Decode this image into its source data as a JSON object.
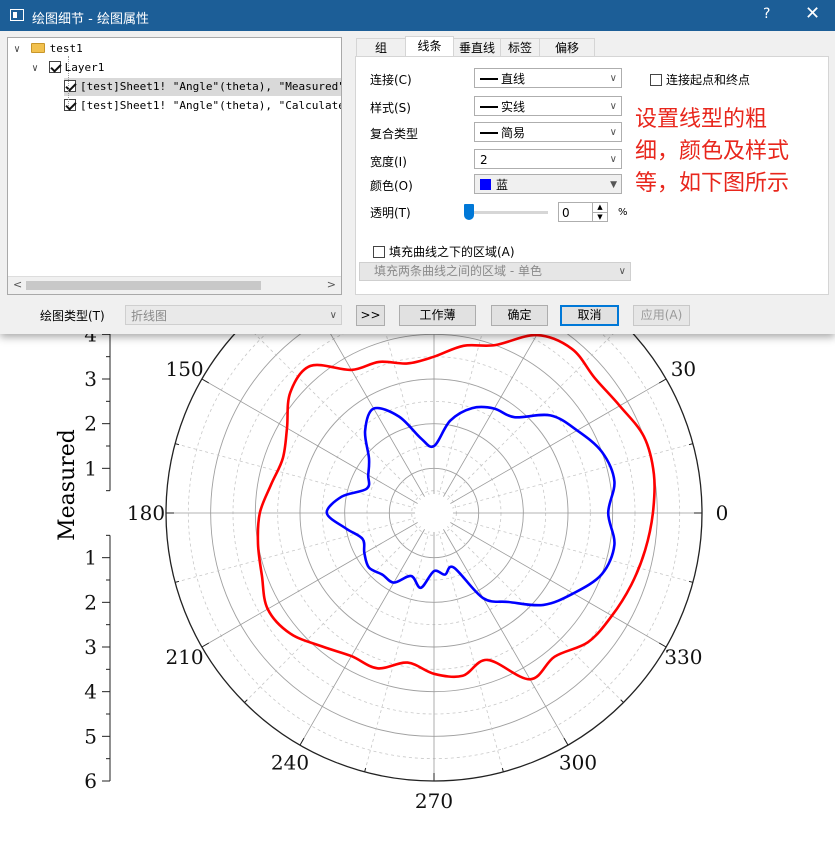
{
  "window": {
    "title": "绘图细节 - 绘图属性",
    "help": "?",
    "close": "✕"
  },
  "tree": {
    "root": "test1",
    "layer": "Layer1",
    "plots": [
      "[test]Sheet1! \"Angle\"(theta), \"Measured\"",
      "[test]Sheet1! \"Angle\"(theta), \"Calculated\""
    ]
  },
  "tabs": [
    "组",
    "线条",
    "垂直线",
    "标签",
    "偏移"
  ],
  "active_tab": "线条",
  "line_settings": {
    "connect_label": "连接(C)",
    "connect_value": "直线",
    "endpoints_label": "连接起点和终点",
    "style_label": "样式(S)",
    "style_value": "实线",
    "composite_label": "复合类型",
    "composite_value": "简易",
    "width_label": "宽度(I)",
    "width_value": "2",
    "color_label": "颜色(O)",
    "color_value": "蓝",
    "color_hex": "#0000ff",
    "transparency_label": "透明(T)",
    "transparency_value": "0",
    "transparency_unit": "%",
    "fill_label": "填充曲线之下的区域(A)",
    "fill_mode": "填充两条曲线之间的区域 - 单色"
  },
  "annotation": {
    "line1": "设置线型的粗",
    "line2": "细，颜色及样式",
    "line3": "等，如下图所示"
  },
  "bottom": {
    "plot_type_label": "绘图类型(T)",
    "plot_type_value": "折线图",
    "expand_btn": ">>",
    "workbook_btn": "工作薄",
    "ok_btn": "确定",
    "cancel_btn": "取消",
    "apply_btn": "应用(A)"
  },
  "chart_data": {
    "type": "polar-line",
    "ylabel": "Measured",
    "angle_ticks": [
      0,
      30,
      150,
      180,
      210,
      240,
      270,
      300,
      330
    ],
    "radial_ticks_upper": [
      "1",
      "2",
      "3",
      "4"
    ],
    "radial_ticks_lower": [
      "1",
      "2",
      "3",
      "4",
      "5",
      "6"
    ],
    "rlim": [
      0,
      6
    ],
    "grid": true,
    "series": [
      {
        "color": "#ff0000",
        "theta": [
          0,
          10,
          20,
          30,
          40,
          50,
          60,
          70,
          80,
          90,
          100,
          110,
          120,
          130,
          140,
          150,
          160,
          170,
          180,
          190,
          200,
          210,
          220,
          230,
          240,
          250,
          260,
          270,
          280,
          290,
          300,
          310,
          320,
          330,
          340,
          350
        ],
        "r": [
          4.9,
          5.0,
          5.0,
          4.8,
          4.7,
          4.8,
          4.6,
          4.0,
          3.8,
          3.5,
          3.4,
          3.6,
          3.7,
          4.3,
          4.2,
          3.8,
          3.6,
          3.7,
          3.9,
          4.0,
          4.1,
          4.3,
          4.2,
          3.9,
          3.7,
          3.7,
          3.4,
          3.6,
          3.7,
          3.5,
          4.3,
          4.2,
          4.5,
          4.6,
          4.7,
          4.8
        ]
      },
      {
        "color": "#0000ff",
        "theta": [
          0,
          10,
          20,
          30,
          40,
          50,
          60,
          70,
          80,
          90,
          100,
          110,
          120,
          130,
          140,
          150,
          160,
          170,
          180,
          190,
          200,
          210,
          220,
          230,
          240,
          250,
          260,
          270,
          280,
          290,
          300,
          310,
          320,
          330,
          340,
          350
        ],
        "r": [
          3.9,
          4.1,
          4.0,
          3.7,
          3.4,
          2.8,
          2.7,
          2.5,
          2.1,
          1.5,
          1.7,
          2.3,
          2.7,
          2.4,
          1.9,
          1.7,
          1.6,
          2.1,
          2.4,
          2.0,
          1.7,
          1.8,
          1.9,
          1.8,
          1.8,
          1.5,
          1.7,
          1.3,
          1.4,
          1.3,
          2.2,
          2.6,
          3.2,
          3.6,
          4.0,
          4.1
        ]
      }
    ]
  }
}
